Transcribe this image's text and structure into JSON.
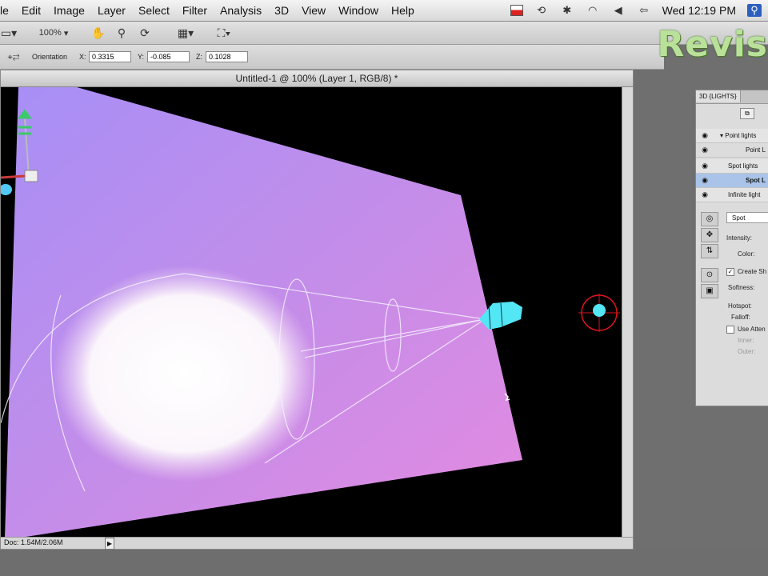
{
  "menubar": {
    "items": [
      "le",
      "Edit",
      "Image",
      "Layer",
      "Select",
      "Filter",
      "Analysis",
      "3D",
      "View",
      "Window",
      "Help"
    ],
    "clock": "Wed 12:19 PM"
  },
  "options_bar": {
    "zoom": "100%"
  },
  "orientation_bar": {
    "label": "Orientation",
    "x_label": "X:",
    "x_value": "0.3315",
    "y_label": "Y:",
    "y_value": "-0.085",
    "z_label": "Z:",
    "z_value": "0.1028"
  },
  "watermark": "Revis",
  "document": {
    "title": "Untitled-1 @ 100% (Layer 1, RGB/8) *",
    "status": "Doc: 1.54M/2.06M"
  },
  "panel": {
    "tab": "3D {LIGHTS}",
    "rows": [
      "Point lights",
      "Point L",
      "Spot lights",
      "Spot L",
      "Infinite light"
    ],
    "preset": "Spot",
    "intensity_label": "Intensity:",
    "color_label": "Color:",
    "create_shadows_label": "Create Sh",
    "softness_label": "Softness:",
    "hotspot_label": "Hotspot:",
    "falloff_label": "Falloff:",
    "use_atten_label": "Use Atten",
    "inner_label": "Inner:",
    "outer_label": "Outer:"
  },
  "colors": {
    "plane_light": "#a98ff5",
    "plane_pink": "#e08ae2",
    "gizmo_cyan": "#53e6f5",
    "gizmo_red": "#e0141e",
    "watermark": "#b9e19a"
  }
}
